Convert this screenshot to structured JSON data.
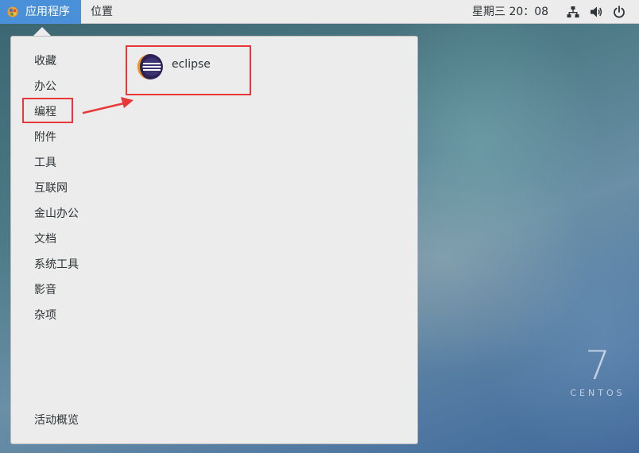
{
  "topbar": {
    "applications_label": "应用程序",
    "places_label": "位置",
    "clock": "星期三 20：08",
    "tray_icons": [
      "network-icon",
      "volume-icon",
      "power-icon"
    ]
  },
  "apps_menu": {
    "categories": [
      {
        "label": "收藏"
      },
      {
        "label": "办公"
      },
      {
        "label": "编程",
        "selected": true
      },
      {
        "label": "附件"
      },
      {
        "label": "工具"
      },
      {
        "label": "互联网"
      },
      {
        "label": "金山办公"
      },
      {
        "label": "文档"
      },
      {
        "label": "系统工具"
      },
      {
        "label": "影音"
      },
      {
        "label": "杂项"
      }
    ],
    "activities_overview": "活动概览",
    "applications": [
      {
        "label": "eclipse",
        "icon": "eclipse-icon"
      }
    ]
  },
  "annotations": {
    "highlight_color": "#e8383a"
  },
  "desktop": {
    "logo_version": "7",
    "logo_wordmark": "CENTOS"
  },
  "colors": {
    "accent": "#4a90d9",
    "panel": "#ececec",
    "text": "#2e3436"
  }
}
